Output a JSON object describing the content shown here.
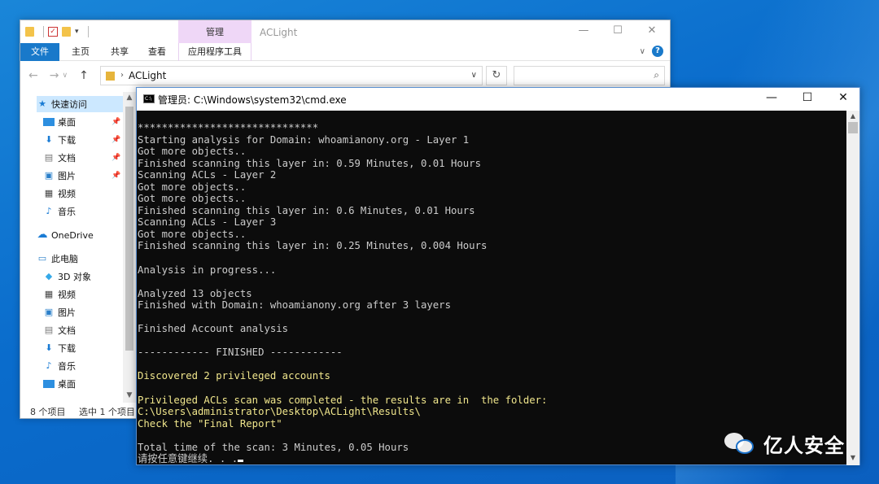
{
  "explorer": {
    "ribbon": {
      "contextual_group": "管理",
      "tabs": [
        "文件",
        "主页",
        "共享",
        "查看"
      ],
      "contextual_tab": "应用程序工具"
    },
    "window_title": "ACLight",
    "address": {
      "path": "ACLight"
    },
    "nav": {
      "quick_access": "快速访问",
      "pinned": [
        "桌面",
        "下载",
        "文档",
        "图片"
      ],
      "quick_other": [
        "视频",
        "音乐"
      ],
      "onedrive": "OneDrive",
      "this_pc": "此电脑",
      "pc_items": [
        "3D 对象",
        "视频",
        "图片",
        "文档",
        "下载",
        "音乐",
        "桌面"
      ]
    },
    "status": {
      "item_count": "8 个项目",
      "selection": "选中 1 个项目"
    }
  },
  "cmd": {
    "title": "管理员: C:\\Windows\\system32\\cmd.exe",
    "lines": [
      "******************************",
      "Starting analysis for Domain: whoamianony.org - Layer 1",
      "Got more objects..",
      "Finished scanning this layer in: 0.59 Minutes, 0.01 Hours",
      "Scanning ACLs - Layer 2",
      "Got more objects..",
      "Got more objects..",
      "Finished scanning this layer in: 0.6 Minutes, 0.01 Hours",
      "Scanning ACLs - Layer 3",
      "Got more objects..",
      "Finished scanning this layer in: 0.25 Minutes, 0.004 Hours",
      "",
      "Analysis in progress...",
      "",
      "Analyzed 13 objects",
      "Finished with Domain: whoamianony.org after 3 layers",
      "",
      "Finished Account analysis",
      "",
      "------------ FINISHED ------------",
      "",
      "Discovered 2 privileged accounts",
      "",
      "Privileged ACLs scan was completed - the results are in  the folder:",
      "C:\\Users\\administrator\\Desktop\\ACLight\\Results\\",
      "Check the \"Final Report\"",
      "",
      "Total time of the scan: 3 Minutes, 0.05 Hours",
      "请按任意键继续. . ."
    ],
    "highlight_color": "#f0e68c",
    "text_color": "#cccccc"
  },
  "watermark": {
    "text": "亿人安全"
  }
}
